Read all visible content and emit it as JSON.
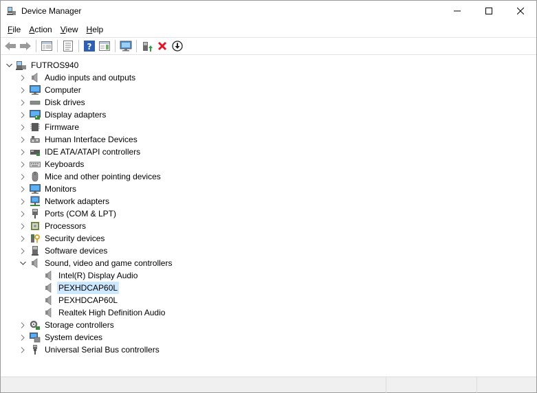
{
  "window": {
    "title": "Device Manager",
    "icon": "device-manager-icon"
  },
  "menu": [
    {
      "label": "File",
      "underline": "F"
    },
    {
      "label": "Action",
      "underline": "A"
    },
    {
      "label": "View",
      "underline": "V"
    },
    {
      "label": "Help",
      "underline": "H"
    }
  ],
  "toolbar": [
    "back-arrow-icon",
    "forward-arrow-icon",
    "show-hide-console-tree-icon",
    "properties-icon",
    "help-icon",
    "action-pane-icon",
    "display-monitor-icon",
    "update-driver-icon",
    "uninstall-device-icon",
    "download-icon"
  ],
  "tree": {
    "root": "FUTROS940",
    "categories": [
      {
        "label": "Audio inputs and outputs",
        "icon": "speaker-icon"
      },
      {
        "label": "Computer",
        "icon": "computer-icon"
      },
      {
        "label": "Disk drives",
        "icon": "disk-drive-icon"
      },
      {
        "label": "Display adapters",
        "icon": "display-adapter-icon"
      },
      {
        "label": "Firmware",
        "icon": "firmware-chip-icon"
      },
      {
        "label": "Human Interface Devices",
        "icon": "hid-icon"
      },
      {
        "label": "IDE ATA/ATAPI controllers",
        "icon": "ide-controller-icon"
      },
      {
        "label": "Keyboards",
        "icon": "keyboard-icon"
      },
      {
        "label": "Mice and other pointing devices",
        "icon": "mouse-icon"
      },
      {
        "label": "Monitors",
        "icon": "monitor-icon"
      },
      {
        "label": "Network adapters",
        "icon": "network-adapter-icon"
      },
      {
        "label": "Ports (COM & LPT)",
        "icon": "port-icon"
      },
      {
        "label": "Processors",
        "icon": "processor-icon"
      },
      {
        "label": "Security devices",
        "icon": "security-key-icon"
      },
      {
        "label": "Software devices",
        "icon": "software-device-icon"
      },
      {
        "label": "Sound, video and game controllers",
        "icon": "speaker-icon",
        "expanded": true,
        "children": [
          {
            "label": "Intel(R) Display Audio",
            "icon": "speaker-icon"
          },
          {
            "label": "PEXHDCAP60L",
            "icon": "speaker-icon",
            "selected": true
          },
          {
            "label": "PEXHDCAP60L",
            "icon": "speaker-icon"
          },
          {
            "label": "Realtek High Definition Audio",
            "icon": "speaker-icon"
          }
        ]
      },
      {
        "label": "Storage controllers",
        "icon": "storage-controller-icon"
      },
      {
        "label": "System devices",
        "icon": "system-device-icon"
      },
      {
        "label": "Universal Serial Bus controllers",
        "icon": "usb-icon"
      }
    ]
  },
  "colors": {
    "selection": "#cce8ff",
    "chevron": "#808080",
    "accent_blue": "#2d7fd1",
    "uninstall_red": "#e81123"
  }
}
